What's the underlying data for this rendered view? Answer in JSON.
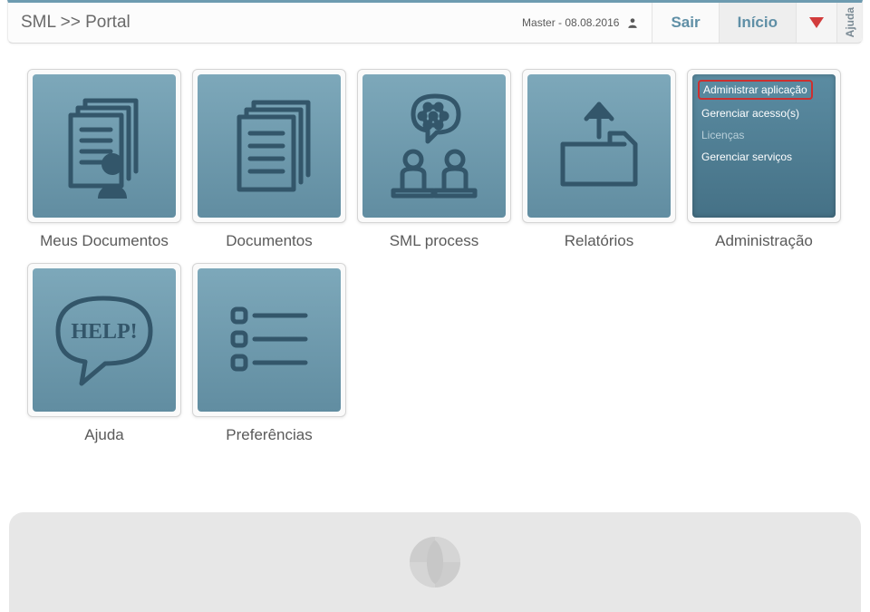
{
  "header": {
    "breadcrumb": "SML >> Portal",
    "user": "Master - 08.08.2016",
    "sair": "Sair",
    "inicio": "Início",
    "ajuda": "Ajuda"
  },
  "tiles": {
    "meus_documentos": "Meus Documentos",
    "documentos": "Documentos",
    "sml_process": "SML process",
    "relatorios": "Relatórios",
    "administracao": "Administração",
    "ajuda": "Ajuda",
    "preferencias": "Preferências"
  },
  "admin_menu": {
    "administrar_aplicacao": "Administrar aplicação",
    "gerenciar_acessos": "Gerenciar acesso(s)",
    "licencas": "Licenças",
    "gerenciar_servicos": "Gerenciar serviços"
  }
}
